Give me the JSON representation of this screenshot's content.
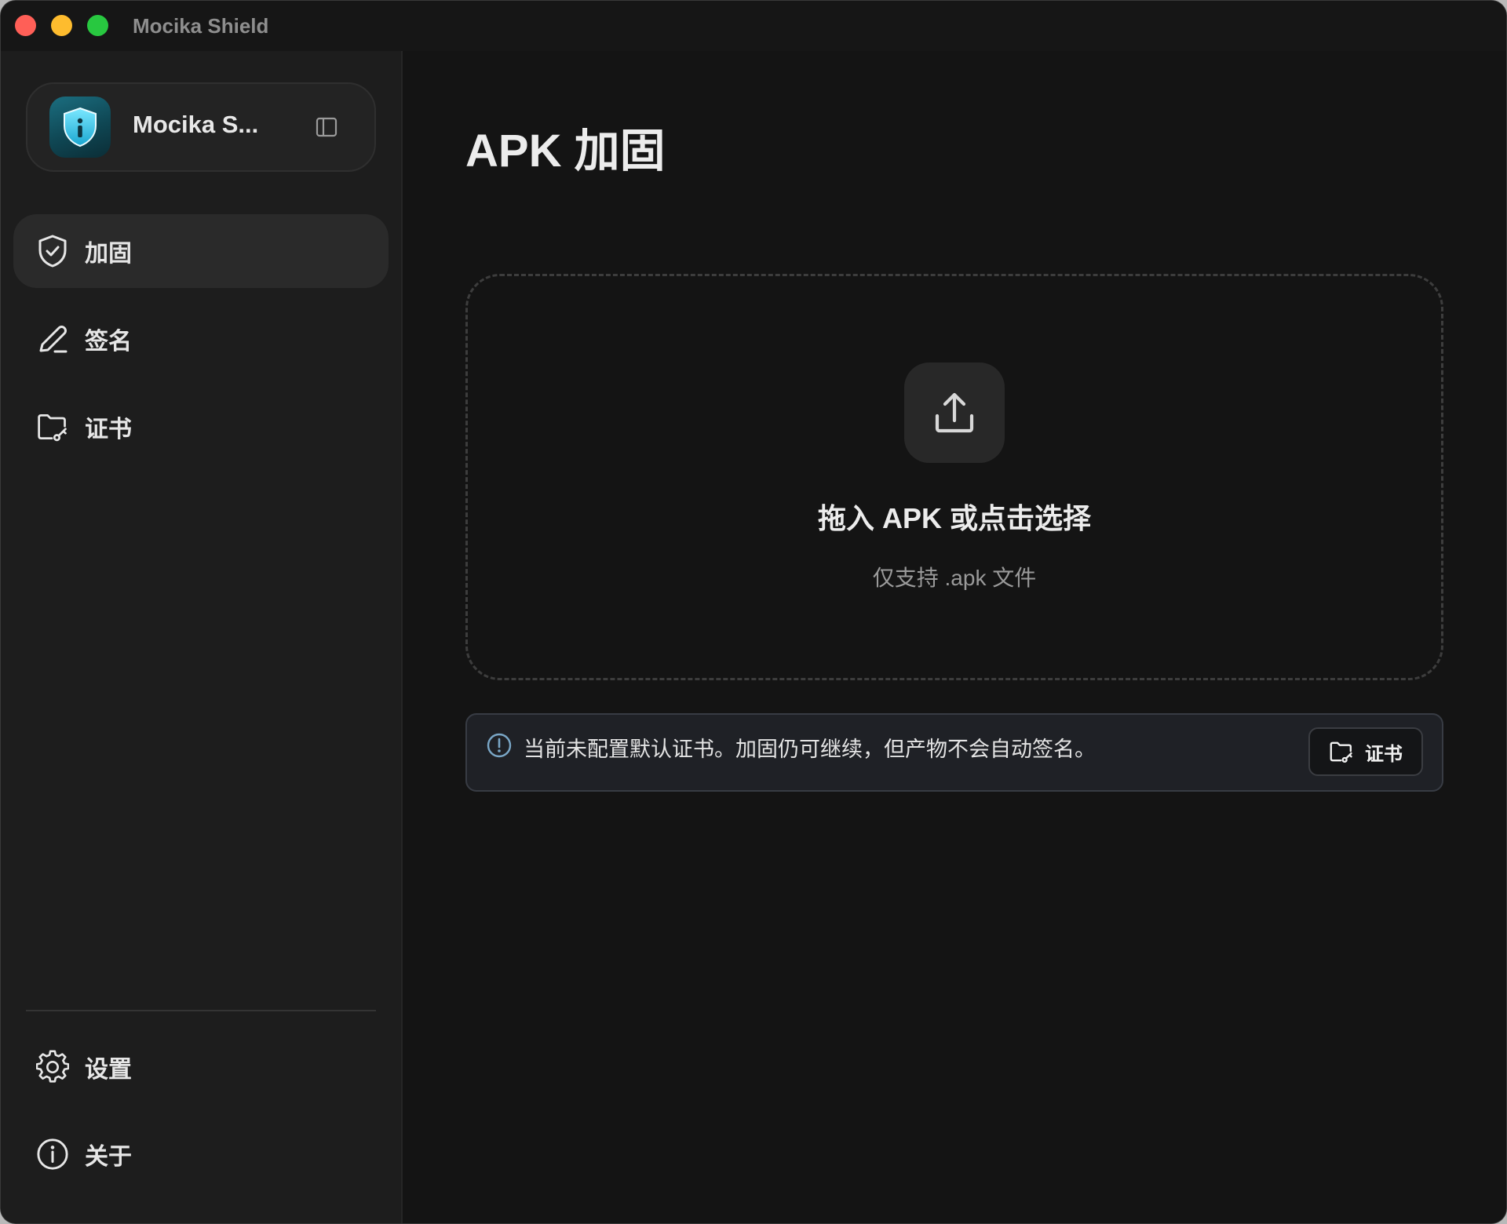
{
  "window": {
    "title": "Mocika Shield"
  },
  "sidebar": {
    "app_name": "Mocika S...",
    "app_icon": "shield-info-icon",
    "items": [
      {
        "label": "加固",
        "icon": "shield-check-icon",
        "active": true
      },
      {
        "label": "签名",
        "icon": "pen-icon",
        "active": false
      },
      {
        "label": "证书",
        "icon": "folder-key-icon",
        "active": false
      }
    ],
    "footer_items": [
      {
        "label": "设置",
        "icon": "gear-icon"
      },
      {
        "label": "关于",
        "icon": "info-icon"
      }
    ]
  },
  "main": {
    "title": "APK 加固",
    "dropzone": {
      "title": "拖入 APK 或点击选择",
      "subtitle": "仅支持 .apk 文件",
      "icon": "upload-icon"
    },
    "notice": {
      "text": "当前未配置默认证书。加固仍可继续，但产物不会自动签名。",
      "button_label": "证书",
      "icon": "alert-circle-icon"
    }
  },
  "colors": {
    "background": "#141414",
    "sidebar": "#1d1d1d",
    "active_item": "#2a2a2a",
    "accent_shield": "#1fb6d6",
    "notice_bg": "#1f2126"
  }
}
